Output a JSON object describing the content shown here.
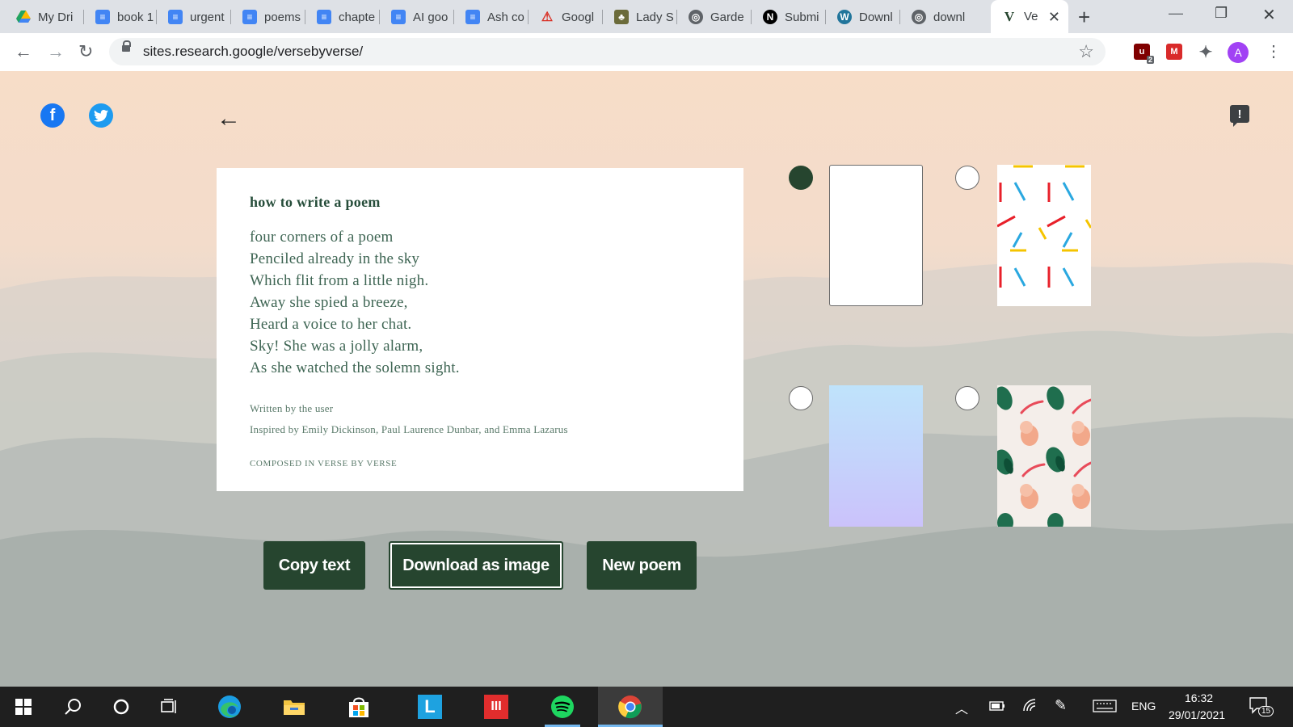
{
  "browser": {
    "tabs": [
      {
        "label": "My Dri",
        "icon": "google-drive-icon",
        "color": "#1fa463"
      },
      {
        "label": "book 1",
        "icon": "google-docs-icon",
        "color": "#4285f4"
      },
      {
        "label": "urgent",
        "icon": "google-docs-icon",
        "color": "#4285f4"
      },
      {
        "label": "poems",
        "icon": "google-docs-icon",
        "color": "#4285f4"
      },
      {
        "label": "chapte",
        "icon": "google-docs-icon",
        "color": "#4285f4"
      },
      {
        "label": "AI goo",
        "icon": "google-docs-icon",
        "color": "#4285f4"
      },
      {
        "label": "Ash co",
        "icon": "google-docs-icon",
        "color": "#4285f4"
      },
      {
        "label": "Googl",
        "icon": "warning-triangle-icon",
        "color": "#d93025"
      },
      {
        "label": "Lady S",
        "icon": "tree-icon",
        "color": "#6b6b3a"
      },
      {
        "label": "Garde",
        "icon": "globe-icon",
        "color": "#5f6368"
      },
      {
        "label": "Submi",
        "icon": "notion-icon",
        "color": "#000000"
      },
      {
        "label": "Downl",
        "icon": "wordpress-icon",
        "color": "#21759b"
      },
      {
        "label": "downl",
        "icon": "globe-icon",
        "color": "#5f6368"
      }
    ],
    "active_tab": {
      "label": "Ve",
      "icon_letter": "V",
      "close": "✕"
    },
    "new_tab": "+",
    "window_controls": {
      "minimize": "—",
      "restore": "❐",
      "close": "✕"
    },
    "url": "sites.research.google/versebyverse/",
    "extensions": [
      {
        "icon": "ublock-icon",
        "color": "#800000",
        "badge": "2"
      },
      {
        "icon": "mendeley-icon",
        "color": "#d92b2b",
        "badge": ""
      },
      {
        "icon": "puzzle-extensions-icon",
        "color": "#5f6368",
        "badge": ""
      }
    ],
    "profile_initial": "A"
  },
  "page": {
    "poem": {
      "title": "how to write a poem",
      "lines": [
        "four corners of a poem",
        "Penciled already in the sky",
        "Which flit from a little nigh.",
        "Away she spied a breeze,",
        "Heard a voice to her chat.",
        "Sky! She was a jolly alarm,",
        "As she watched the solemn sight."
      ],
      "written_by": "Written by the user",
      "inspired_by": "Inspired by Emily Dickinson, Paul Laurence Dunbar, and Emma Lazarus",
      "composed_in": "COMPOSED IN VERSE BY VERSE"
    },
    "buttons": {
      "copy": "Copy text",
      "download": "Download as image",
      "new_poem": "New poem"
    },
    "themes": [
      {
        "name": "plain-white",
        "selected": true
      },
      {
        "name": "confetti-lines",
        "selected": false
      },
      {
        "name": "blue-lavender-gradient",
        "selected": false
      },
      {
        "name": "leaf-pattern",
        "selected": false
      }
    ],
    "colors": {
      "accent": "#26452f",
      "poem_text": "#3e6553"
    }
  },
  "taskbar": {
    "apps": [
      {
        "icon": "windows-start-icon"
      },
      {
        "icon": "search-icon"
      },
      {
        "icon": "cortana-icon"
      },
      {
        "icon": "task-view-icon"
      },
      {
        "icon": "edge-icon"
      },
      {
        "icon": "file-explorer-icon"
      },
      {
        "icon": "microsoft-store-icon"
      },
      {
        "icon": "l-app-icon",
        "label": "L"
      },
      {
        "icon": "red-app-icon"
      },
      {
        "icon": "spotify-icon"
      },
      {
        "icon": "chrome-icon"
      }
    ],
    "language": "ENG",
    "time": "16:32",
    "date": "29/01/2021",
    "notifications": "15"
  }
}
